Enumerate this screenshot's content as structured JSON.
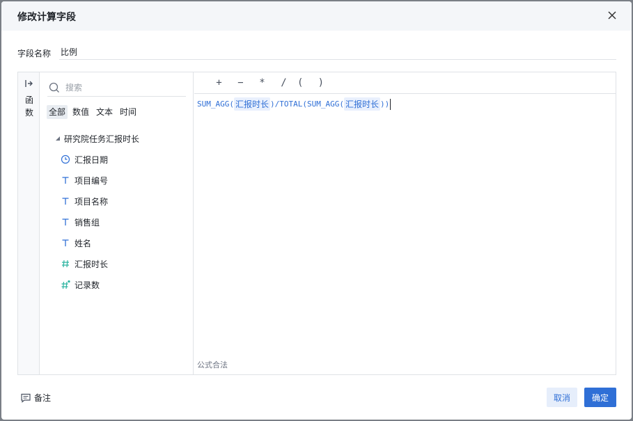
{
  "dialog": {
    "title": "修改计算字段",
    "close_icon": "close-icon"
  },
  "field_name": {
    "label": "字段名称",
    "value": "比例"
  },
  "function_tab": {
    "icon": "expand-arrow-icon",
    "label_line1": "函",
    "label_line2": "数"
  },
  "search": {
    "icon": "search-icon",
    "placeholder": "搜索"
  },
  "type_tabs": [
    "全部",
    "数值",
    "文本",
    "时间"
  ],
  "tree": {
    "group_label": "研究院任务汇报时长",
    "items": [
      {
        "label": "汇报日期",
        "type": "date"
      },
      {
        "label": "项目编号",
        "type": "text"
      },
      {
        "label": "项目名称",
        "type": "text"
      },
      {
        "label": "销售组",
        "type": "text"
      },
      {
        "label": "姓名",
        "type": "text"
      },
      {
        "label": "汇报时长",
        "type": "number"
      },
      {
        "label": "记录数",
        "type": "count"
      }
    ]
  },
  "operators": [
    "+",
    "−",
    "*",
    "/"
  ],
  "parens": [
    "(",
    ")"
  ],
  "formula": {
    "fn1": "SUM_AGG",
    "field1": "汇报时长",
    "mid": "/TOTAL",
    "fn2": "SUM_AGG",
    "field2": "汇报时长"
  },
  "validation": "公式合法",
  "footer": {
    "note_label": "备注",
    "cancel_label": "取消",
    "ok_label": "确定"
  },
  "colors": {
    "accent": "#2f6fd6",
    "number_icon": "#2bb3a0"
  }
}
